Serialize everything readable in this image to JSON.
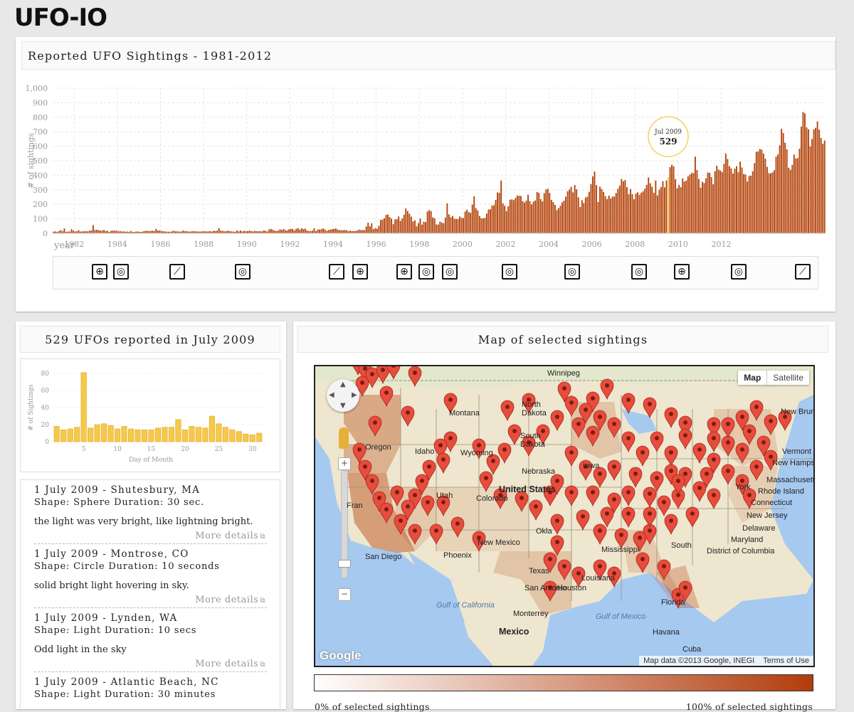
{
  "logo": {
    "text": "UFO-IO"
  },
  "timeline": {
    "title": "Reported UFO Sightings - 1981-2012",
    "ylabel": "# of sightings",
    "xlabel": "year",
    "tooltip": {
      "label": "Jul 2009",
      "value": "529"
    },
    "icons": [
      "globe-icon",
      "film-icon",
      "telescope-icon",
      "film-icon",
      "telescope-icon",
      "globe-icon",
      "globe-icon",
      "film-icon",
      "film-icon",
      "film-icon",
      "film-icon",
      "film-icon",
      "globe-icon",
      "film-icon",
      "telescope-icon"
    ]
  },
  "month_panel": {
    "title": "529 UFOs reported in July 2009"
  },
  "sightings": [
    {
      "header": "1 July 2009 - Shutesbury, MA",
      "shape_label": "Shape:",
      "shape": "Sphere",
      "duration_label": "Duration:",
      "duration": "30 sec.",
      "description": "the light was very bright, like lightning bright.",
      "more": "More details"
    },
    {
      "header": "1 July 2009 - Montrose, CO",
      "shape_label": "Shape:",
      "shape": "Circle",
      "duration_label": "Duration:",
      "duration": "10 seconds",
      "description": "solid bright light hovering in sky.",
      "more": "More details"
    },
    {
      "header": "1 July 2009 - Lynden, WA",
      "shape_label": "Shape:",
      "shape": "Light",
      "duration_label": "Duration:",
      "duration": "10 secs",
      "description": "Odd light in the sky",
      "more": "More details"
    },
    {
      "header": "1 July 2009 - Atlantic Beach, NC",
      "shape_label": "Shape:",
      "shape": "Light",
      "duration_label": "Duration:",
      "duration": "30 minutes",
      "description": "",
      "more": ""
    }
  ],
  "map_panel": {
    "title": "Map of selected sightings",
    "toggle": {
      "map": "Map",
      "satellite": "Satellite"
    },
    "footer": {
      "data": "Map data ©2013 Google, INEGI",
      "terms": "Terms of Use"
    },
    "google": "Google",
    "legend": {
      "min_label": "0% of selected sightings",
      "max_label": "100% of selected sightings",
      "colors": [
        "#ffffff",
        "#b23c0c"
      ]
    },
    "labels": {
      "winnipeg": "Winnipeg",
      "montana": "Montana",
      "north_dakota_1": "North",
      "north_dakota_2": "Dakota",
      "south_dakota_1": "South",
      "south_dakota_2": "Dakota",
      "oregon": "Oregon",
      "idaho": "Idaho",
      "wyoming": "Wyoming",
      "nebraska": "Nebraska",
      "utah": "Utah",
      "united_states": "United States",
      "colorado": "Colorado",
      "iowa": "Iowa",
      "new_mexico": "New Mexico",
      "phoenix": "Phoenix",
      "san_diego": "San Diego",
      "texas": "Texas",
      "san_antonio": "San Antonio",
      "houston": "Houston",
      "louisiana": "Louisiana",
      "mississippi": "Mississippi",
      "gulf_california": "Gulf of California",
      "monterrey": "Monterrey",
      "mexico": "Mexico",
      "gulf_mexico": "Gulf of Mexico",
      "havana": "Havana",
      "cuba": "Cuba",
      "new_brunswick": "New Brunswick",
      "vermont": "Vermont",
      "new_hampshire": "New Hampshire",
      "massachusetts": "Massachusetts",
      "york": "York",
      "rhode_island": "Rhode Island",
      "connecticut": "Connecticut",
      "new_jersey": "New Jersey",
      "delaware": "Delaware",
      "maryland": "Maryland",
      "dc": "District of Columbia",
      "south": "South",
      "florida": "Florida",
      "oklahoma": "Okla",
      "fran": "Fran"
    }
  },
  "chart_data": [
    {
      "type": "bar",
      "title": "Reported UFO Sightings - 1981-2012",
      "xlabel": "year",
      "ylabel": "# of sightings",
      "ylim": [
        0,
        1000
      ],
      "yticks": [
        0,
        100,
        200,
        300,
        400,
        500,
        600,
        700,
        800,
        900,
        "1,000"
      ],
      "xticks": [
        "1982",
        "1984",
        "1986",
        "1988",
        "1990",
        "1992",
        "1994",
        "1996",
        "1998",
        "2000",
        "2002",
        "2004",
        "2006",
        "2008",
        "2010",
        "2012"
      ],
      "x_start": "1981-01",
      "highlight": {
        "x": "2009-07",
        "value": 529
      },
      "colors": {
        "bar": "#b5470f",
        "highlight": "#f5d060"
      },
      "values": [
        11,
        13,
        9,
        15,
        22,
        14,
        34,
        10,
        12,
        12,
        28,
        18,
        13,
        14,
        21,
        12,
        13,
        14,
        15,
        13,
        18,
        19,
        57,
        23,
        24,
        23,
        19,
        18,
        23,
        16,
        17,
        9,
        17,
        19,
        18,
        18,
        13,
        16,
        12,
        13,
        11,
        12,
        10,
        16,
        9,
        10,
        12,
        12,
        10,
        10,
        14,
        16,
        18,
        15,
        17,
        18,
        15,
        30,
        19,
        19,
        16,
        14,
        13,
        11,
        11,
        9,
        14,
        18,
        13,
        14,
        11,
        12,
        19,
        15,
        14,
        13,
        11,
        14,
        15,
        13,
        13,
        12,
        12,
        14,
        14,
        13,
        13,
        15,
        12,
        17,
        16,
        18,
        36,
        18,
        17,
        14,
        14,
        18,
        15,
        13,
        12,
        10,
        19,
        13,
        19,
        13,
        17,
        14,
        15,
        19,
        15,
        13,
        17,
        14,
        14,
        15,
        13,
        20,
        17,
        13,
        28,
        30,
        24,
        18,
        16,
        18,
        28,
        23,
        30,
        20,
        20,
        27,
        31,
        30,
        19,
        31,
        36,
        25,
        35,
        29,
        32,
        20,
        15,
        16,
        18,
        35,
        15,
        26,
        26,
        28,
        34,
        26,
        17,
        23,
        25,
        29,
        30,
        34,
        26,
        22,
        22,
        21,
        23,
        22,
        15,
        18,
        15,
        15,
        16,
        19,
        26,
        22,
        23,
        22,
        47,
        73,
        48,
        69,
        28,
        36,
        32,
        52,
        93,
        94,
        103,
        127,
        129,
        112,
        101,
        63,
        95,
        98,
        116,
        86,
        103,
        128,
        171,
        153,
        135,
        115,
        81,
        90,
        48,
        71,
        102,
        60,
        80,
        78,
        150,
        160,
        153,
        110,
        103,
        61,
        60,
        80,
        74,
        69,
        108,
        206,
        130,
        110,
        120,
        100,
        99,
        98,
        116,
        106,
        105,
        150,
        163,
        146,
        141,
        198,
        255,
        173,
        157,
        119,
        104,
        103,
        106,
        136,
        164,
        166,
        191,
        193,
        230,
        282,
        279,
        364,
        207,
        190,
        153,
        186,
        231,
        234,
        229,
        244,
        260,
        259,
        257,
        222,
        212,
        225,
        266,
        221,
        199,
        218,
        226,
        285,
        279,
        236,
        220,
        276,
        302,
        307,
        278,
        230,
        215,
        196,
        160,
        173,
        190,
        213,
        225,
        253,
        290,
        302,
        321,
        282,
        333,
        303,
        248,
        181,
        229,
        209,
        247,
        253,
        286,
        339,
        392,
        426,
        332,
        216,
        321,
        305,
        285,
        256,
        236,
        260,
        240,
        253,
        254,
        278,
        307,
        329,
        374,
        358,
        367,
        318,
        269,
        305,
        269,
        235,
        274,
        283,
        264,
        280,
        289,
        307,
        334,
        385,
        345,
        321,
        279,
        364,
        261,
        301,
        319,
        359,
        317,
        364,
        388,
        456,
        472,
        462,
        373,
        310,
        334,
        318,
        379,
        357,
        363,
        392,
        404,
        415,
        415,
        529,
        436,
        374,
        315,
        355,
        346,
        379,
        419,
        417,
        388,
        338,
        427,
        466,
        439,
        432,
        422,
        479,
        550,
        512,
        463,
        447,
        412,
        445,
        463,
        421,
        494,
        454,
        408,
        405,
        357,
        395,
        397,
        427,
        484,
        561,
        564,
        581,
        576,
        549,
        514,
        458,
        414,
        413,
        420,
        435,
        528,
        543,
        606,
        720,
        691,
        624,
        579,
        452,
        438,
        472,
        543,
        516,
        518,
        583,
        735,
        836,
        826,
        730,
        717,
        599,
        650,
        716,
        727,
        771,
        714,
        657,
        617,
        640
      ]
    },
    {
      "type": "bar",
      "xlabel": "Day of Month",
      "ylabel": "# of Sightings",
      "ylim": [
        0,
        80
      ],
      "yticks": [
        0,
        20,
        40,
        60,
        80
      ],
      "xticks": [
        5,
        10,
        15,
        20,
        25,
        30
      ],
      "categories": [
        1,
        2,
        3,
        4,
        5,
        6,
        7,
        8,
        9,
        10,
        11,
        12,
        13,
        14,
        15,
        16,
        17,
        18,
        19,
        20,
        21,
        22,
        23,
        24,
        25,
        26,
        27,
        28,
        29,
        30,
        31
      ],
      "values": [
        18,
        14,
        15,
        17,
        81,
        16,
        20,
        21,
        19,
        15,
        18,
        15,
        14,
        14,
        14,
        16,
        17,
        17,
        26,
        14,
        18,
        17,
        16,
        30,
        21,
        17,
        14,
        12,
        9,
        8,
        10
      ],
      "colors": {
        "bar": "#f7c84a",
        "stroke": "#d8a827"
      }
    }
  ]
}
